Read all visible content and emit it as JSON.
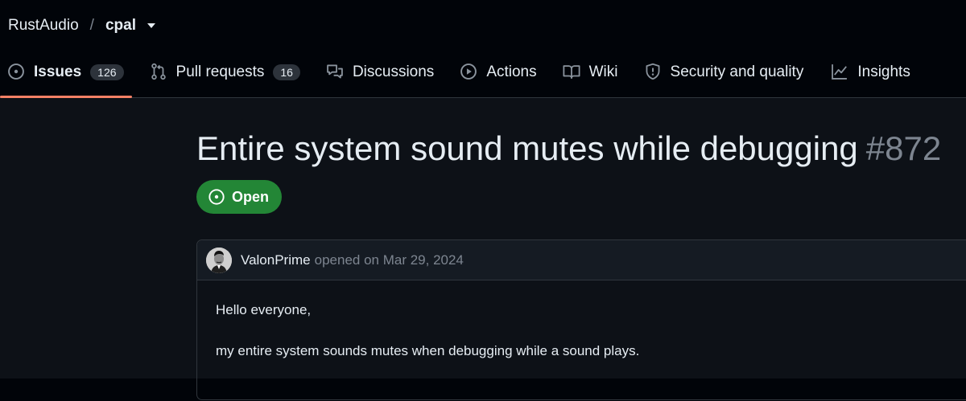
{
  "repo": {
    "owner": "RustAudio",
    "separator": "/",
    "name": "cpal"
  },
  "tabs": [
    {
      "label": "Issues",
      "count": "126",
      "icon": "issue-opened-icon",
      "active": true
    },
    {
      "label": "Pull requests",
      "count": "16",
      "icon": "git-pull-request-icon"
    },
    {
      "label": "Discussions",
      "icon": "comment-discussion-icon"
    },
    {
      "label": "Actions",
      "icon": "play-icon"
    },
    {
      "label": "Wiki",
      "icon": "book-icon"
    },
    {
      "label": "Security and quality",
      "icon": "shield-icon"
    },
    {
      "label": "Insights",
      "icon": "graph-icon"
    }
  ],
  "issue": {
    "title": "Entire system sound mutes while debugging",
    "number": "#872",
    "state": "Open",
    "state_color": "#238636"
  },
  "comment": {
    "author": "ValonPrime",
    "action": "opened on Mar 29, 2024",
    "body": [
      "Hello everyone,",
      "my entire system sounds mutes when debugging while a sound plays."
    ]
  },
  "colors": {
    "accent_underline": "#f78166",
    "background": "#0d1117",
    "header_background": "#010409"
  }
}
